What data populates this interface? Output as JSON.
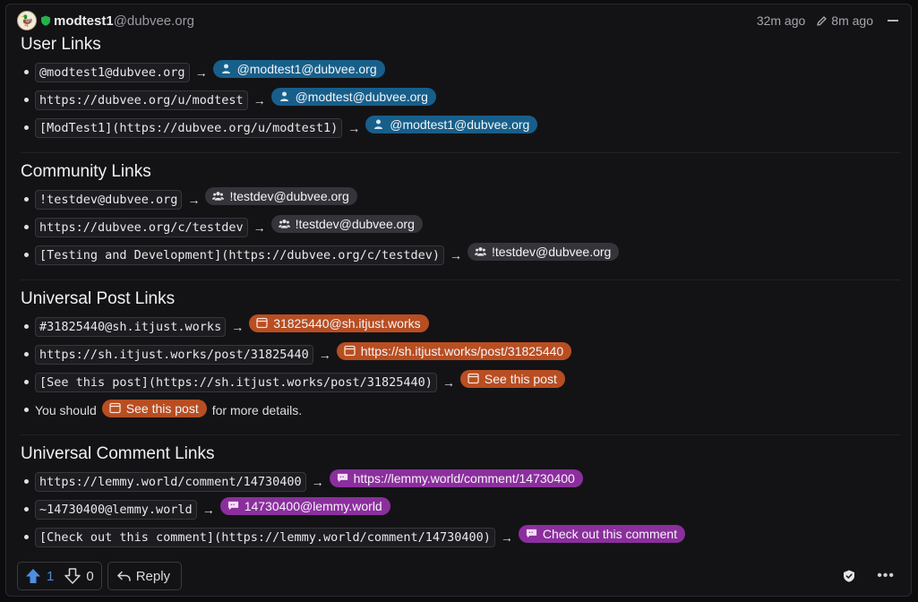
{
  "header": {
    "avatar_emoji": "🦆",
    "username": "modtest1",
    "userdomain": "@dubvee.org",
    "created": "32m ago",
    "edited": "8m ago"
  },
  "arrow": "→",
  "sections": [
    {
      "title": "User Links",
      "type": "user",
      "items": [
        {
          "code": "@modtest1@dubvee.org",
          "pill": "@modtest1@dubvee.org"
        },
        {
          "code": "https://dubvee.org/u/modtest",
          "pill": "@modtest@dubvee.org"
        },
        {
          "code": "[ModTest1](https://dubvee.org/u/modtest1)",
          "pill": "@modtest1@dubvee.org"
        }
      ]
    },
    {
      "title": "Community Links",
      "type": "community",
      "items": [
        {
          "code": "!testdev@dubvee.org",
          "pill": "!testdev@dubvee.org"
        },
        {
          "code": "https://dubvee.org/c/testdev",
          "pill": "!testdev@dubvee.org"
        },
        {
          "code": "[Testing and Development](https://dubvee.org/c/testdev)",
          "pill": "!testdev@dubvee.org"
        }
      ]
    },
    {
      "title": "Universal Post Links",
      "type": "post",
      "items": [
        {
          "code": "#31825440@sh.itjust.works",
          "pill": "31825440@sh.itjust.works"
        },
        {
          "code": "https://sh.itjust.works/post/31825440",
          "pill": "https://sh.itjust.works/post/31825440"
        },
        {
          "code": "[See this post](https://sh.itjust.works/post/31825440)",
          "pill": "See this post"
        }
      ],
      "sentence": {
        "before": "You should",
        "pill": "See this post",
        "after": "for more details."
      }
    },
    {
      "title": "Universal Comment Links",
      "type": "comment",
      "items": [
        {
          "code": "https://lemmy.world/comment/14730400",
          "pill": "https://lemmy.world/comment/14730400"
        },
        {
          "code": "~14730400@lemmy.world",
          "pill": "14730400@lemmy.world"
        },
        {
          "code": "[Check out this comment](https://lemmy.world/comment/14730400)",
          "pill": "Check out this comment"
        }
      ]
    }
  ],
  "footer": {
    "upvotes": "1",
    "downvotes": "0",
    "reply_label": "Reply"
  },
  "colors": {
    "user_pill": "#175f8a",
    "community_pill": "#34343a",
    "post_pill": "#b84e22",
    "comment_pill": "#8b2f9d",
    "upvote_accent": "#4e8ee0"
  }
}
